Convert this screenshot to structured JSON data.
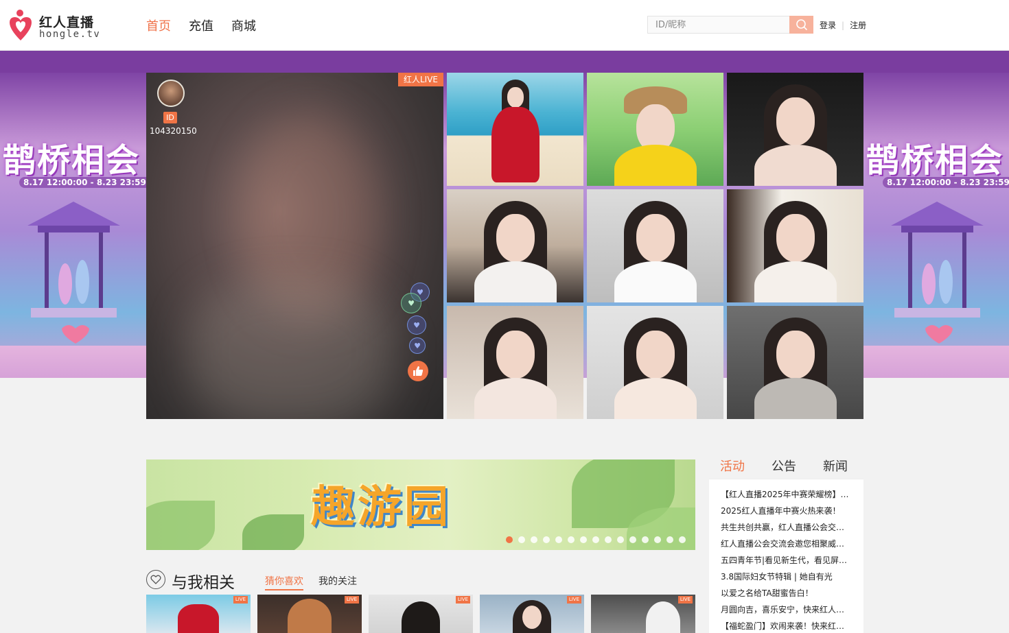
{
  "brand": {
    "title": "红人直播",
    "subtitle": "hongle.tv",
    "accent": "#f07446"
  },
  "nav": {
    "items": [
      "首页",
      "充值",
      "商城"
    ],
    "active_index": 0
  },
  "search": {
    "placeholder": "ID/昵称"
  },
  "auth": {
    "login": "登录",
    "register": "注册"
  },
  "banner": {
    "event_title": "鹊桥相会",
    "event_dates": "8.17 12:00:00 - 8.23 23:59:59"
  },
  "player": {
    "tag": "红人LIVE",
    "id_label": "ID",
    "id_number": "104320150"
  },
  "promo": {
    "title": "趣游园",
    "dot_count": 15,
    "active_dot": 0
  },
  "related": {
    "title": "与我相关",
    "tabs": [
      "猜你喜欢",
      "我的关注"
    ],
    "active_tab": 0,
    "live_label": "LIVE"
  },
  "news": {
    "tabs": [
      "活动",
      "公告",
      "新闻"
    ],
    "active_tab": 0,
    "items": [
      "【红人直播2025年中赛荣耀榜】…",
      "2025红人直播年中赛火热来袭！",
      "共生共创共赢，红人直播公会交…",
      "红人直播公会交流会邀您相聚威…",
      "五四青年节|看见新生代，看见屏…",
      "3.8国际妇女节特辑 | 她自有光",
      "以爱之名给TA甜蜜告白！",
      "月圆向吉，喜乐安宁，快来红人…",
      "【福蛇盈门】欢闹来袭！快来红…"
    ]
  }
}
